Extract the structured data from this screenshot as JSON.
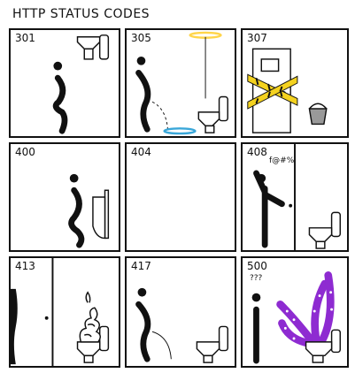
{
  "title": "HTTP STATUS CODES",
  "panels": [
    {
      "code": "301"
    },
    {
      "code": "305"
    },
    {
      "code": "307"
    },
    {
      "code": "400"
    },
    {
      "code": "404"
    },
    {
      "code": "408"
    },
    {
      "code": "413"
    },
    {
      "code": "417"
    },
    {
      "code": "500"
    }
  ],
  "annotations": {
    "expletive": "f@#%",
    "confusion": "???"
  },
  "colors": {
    "ink": "#111111",
    "portal_blue": "#3aa7d9",
    "portal_yellow": "#ffd54a",
    "tape_yellow": "#f4d21f",
    "tentacle_purple": "#8e2bd1"
  }
}
